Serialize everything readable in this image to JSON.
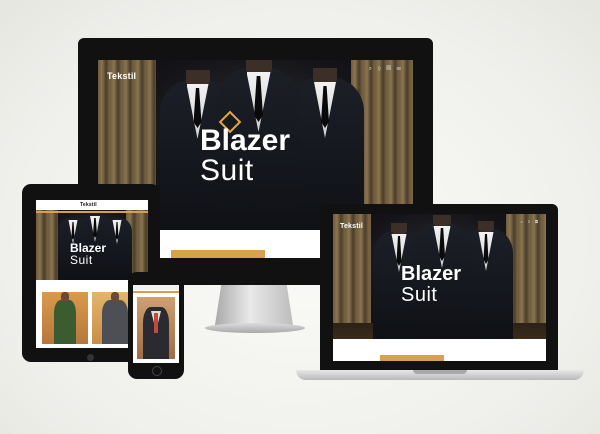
{
  "site": {
    "logo": "Tekstil",
    "hero_title": "Blazer",
    "hero_subtitle": "Suit"
  },
  "colors": {
    "accent": "#d9a14b",
    "background": "#f3f3f0",
    "device_frame": "#111111"
  }
}
